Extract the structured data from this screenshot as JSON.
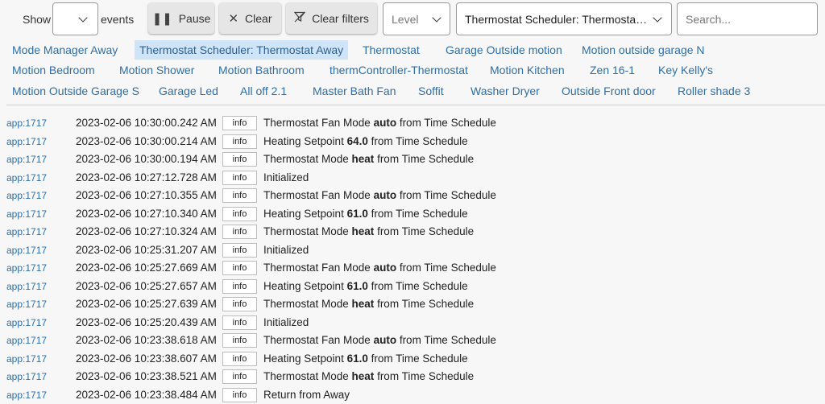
{
  "toolbar": {
    "show_label": "Show",
    "events_label": "events",
    "show_value": "",
    "pause_label": "Pause",
    "clear_label": "Clear",
    "clear_filters_label": "Clear filters",
    "level_placeholder": "Level",
    "device_filter_value": "Thermostat Scheduler: Thermosta…",
    "search_placeholder": "Search..."
  },
  "chips": [
    [
      "Mode Manager Away",
      "Thermostat Scheduler: Thermostat Away",
      "Thermostat",
      "Garage Outside motion",
      "Motion outside garage N"
    ],
    [
      "Motion Bedroom",
      "Motion Shower",
      "Motion Bathroom",
      "thermController-Thermostat",
      "Motion Kitchen",
      "Zen 16-1",
      "Key Kelly's"
    ],
    [
      "Motion Outside Garage S",
      "Garage Led",
      "All off 2.1",
      "Master Bath Fan",
      "Soffit",
      "Washer Dryer",
      "Outside Front door",
      "Roller shade 3"
    ]
  ],
  "active_chip": "Thermostat Scheduler: Thermostat Away",
  "logs": [
    {
      "app": "app:1717",
      "ts": "2023-02-06 10:30:00.242 AM",
      "level": "info",
      "pre": "Thermostat Fan Mode ",
      "bold": "auto",
      "post": " from Time Schedule"
    },
    {
      "app": "app:1717",
      "ts": "2023-02-06 10:30:00.214 AM",
      "level": "info",
      "pre": "Heating Setpoint ",
      "bold": "64.0",
      "post": " from Time Schedule"
    },
    {
      "app": "app:1717",
      "ts": "2023-02-06 10:30:00.194 AM",
      "level": "info",
      "pre": "Thermostat Mode ",
      "bold": "heat",
      "post": " from Time Schedule"
    },
    {
      "app": "app:1717",
      "ts": "2023-02-06 10:27:12.728 AM",
      "level": "info",
      "pre": "Initialized",
      "bold": "",
      "post": ""
    },
    {
      "app": "app:1717",
      "ts": "2023-02-06 10:27:10.355 AM",
      "level": "info",
      "pre": "Thermostat Fan Mode ",
      "bold": "auto",
      "post": " from Time Schedule"
    },
    {
      "app": "app:1717",
      "ts": "2023-02-06 10:27:10.340 AM",
      "level": "info",
      "pre": "Heating Setpoint ",
      "bold": "61.0",
      "post": " from Time Schedule"
    },
    {
      "app": "app:1717",
      "ts": "2023-02-06 10:27:10.324 AM",
      "level": "info",
      "pre": "Thermostat Mode ",
      "bold": "heat",
      "post": " from Time Schedule"
    },
    {
      "app": "app:1717",
      "ts": "2023-02-06 10:25:31.207 AM",
      "level": "info",
      "pre": "Initialized",
      "bold": "",
      "post": ""
    },
    {
      "app": "app:1717",
      "ts": "2023-02-06 10:25:27.669 AM",
      "level": "info",
      "pre": "Thermostat Fan Mode ",
      "bold": "auto",
      "post": " from Time Schedule"
    },
    {
      "app": "app:1717",
      "ts": "2023-02-06 10:25:27.657 AM",
      "level": "info",
      "pre": "Heating Setpoint ",
      "bold": "61.0",
      "post": " from Time Schedule"
    },
    {
      "app": "app:1717",
      "ts": "2023-02-06 10:25:27.639 AM",
      "level": "info",
      "pre": "Thermostat Mode ",
      "bold": "heat",
      "post": " from Time Schedule"
    },
    {
      "app": "app:1717",
      "ts": "2023-02-06 10:25:20.439 AM",
      "level": "info",
      "pre": "Initialized",
      "bold": "",
      "post": ""
    },
    {
      "app": "app:1717",
      "ts": "2023-02-06 10:23:38.618 AM",
      "level": "info",
      "pre": "Thermostat Fan Mode ",
      "bold": "auto",
      "post": " from Time Schedule"
    },
    {
      "app": "app:1717",
      "ts": "2023-02-06 10:23:38.607 AM",
      "level": "info",
      "pre": "Heating Setpoint ",
      "bold": "61.0",
      "post": " from Time Schedule"
    },
    {
      "app": "app:1717",
      "ts": "2023-02-06 10:23:38.521 AM",
      "level": "info",
      "pre": "Thermostat Mode ",
      "bold": "heat",
      "post": " from Time Schedule"
    },
    {
      "app": "app:1717",
      "ts": "2023-02-06 10:23:38.484 AM",
      "level": "info",
      "pre": "Return from Away",
      "bold": "",
      "post": ""
    }
  ],
  "icons": {
    "pause": "pause-icon",
    "clear": "close-icon",
    "clear_filters": "filter-off-icon",
    "dropdown": "chevron-down-icon"
  },
  "colors": {
    "link": "#2f6ea6",
    "active_chip_bg": "#cfe4f7",
    "background": "#f7f7f7"
  }
}
